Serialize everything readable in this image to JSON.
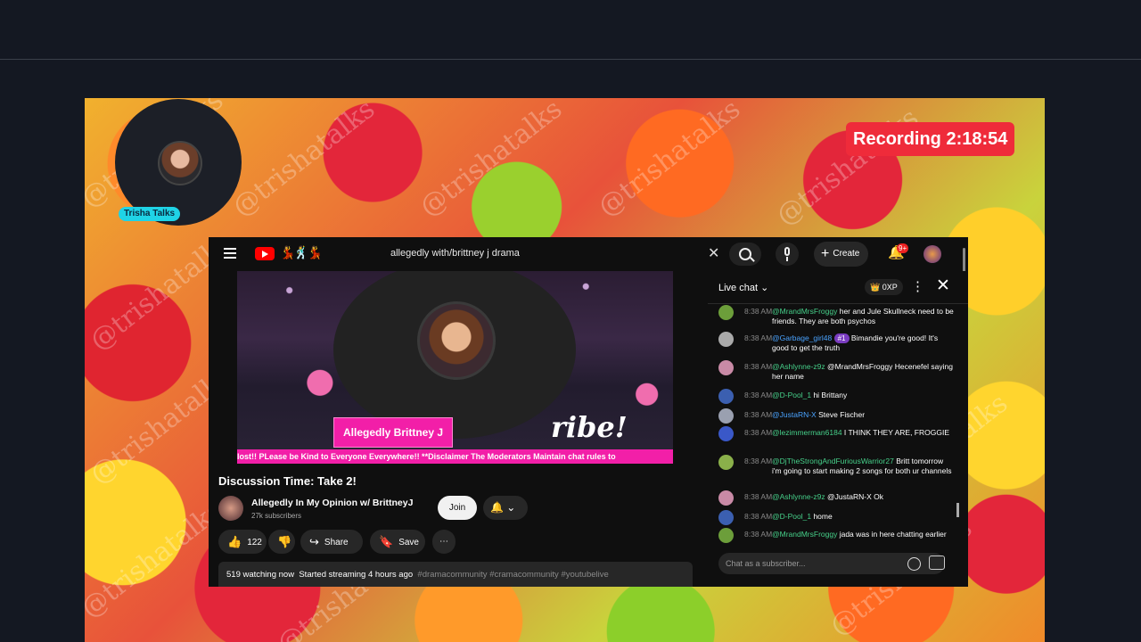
{
  "recording": {
    "label": "Recording 2:18:54"
  },
  "webcam": {
    "name": "Trisha Talks"
  },
  "watermark": "@trishatalks",
  "youtube": {
    "search_query": "allegedly with/brittney j drama",
    "create_label": "Create",
    "notification_count": "9+",
    "video": {
      "name_card": "Allegedly Brittney J",
      "overlay_text": "ribe!",
      "ticker": "lost!! PLease be Kind to Everyone Everywhere!! **Disclaimer The Moderators Maintain chat rules to"
    },
    "title": "Discussion Time: Take 2!",
    "channel": {
      "name": "Allegedly In My Opinion w/ BrittneyJ",
      "subs": "27k subscribers"
    },
    "join_label": "Join",
    "likes": "122",
    "share_label": "Share",
    "save_label": "Save",
    "description": {
      "watching": "519 watching now",
      "started": "Started streaming 4 hours ago",
      "tags": "#dramacommunity #cramacommunity #youtubelive"
    }
  },
  "chat": {
    "title": "Live chat",
    "xp": "0XP",
    "placeholder": "Chat as a subscriber...",
    "messages": [
      {
        "time": "8:38 AM",
        "user": "@MrandMrsFroggy",
        "text": "her and Jule Skullneck need to be friends. They are both psychos"
      },
      {
        "time": "8:38 AM",
        "user": "@Garbage_girl48",
        "badge": "#1",
        "text": "Bimandie you're good! It's good to get the truth"
      },
      {
        "time": "8:38 AM",
        "user": "@Ashlynne-z9z",
        "text": "@MrandMrsFroggy Hecenefel saying her name"
      },
      {
        "time": "8:38 AM",
        "user": "@D-Pool_1",
        "text": "hi Brittany"
      },
      {
        "time": "8:38 AM",
        "user": "@JustaRN-X",
        "text": "Steve Fischer"
      },
      {
        "time": "8:38 AM",
        "user": "@lezimmerman6184",
        "text": "I THINK THEY ARE, FROGGIE"
      },
      {
        "time": "8:38 AM",
        "user": "@DjTheStrongAndFuriousWarrior27",
        "text": "Britt tomorrow i'm going to start making 2 songs for both ur channels"
      },
      {
        "time": "8:38 AM",
        "user": "@Ashlynne-z9z",
        "text": "@JustaRN-X Ok"
      },
      {
        "time": "8:38 AM",
        "user": "@D-Pool_1",
        "text": "home"
      },
      {
        "time": "8:38 AM",
        "user": "@MrandMrsFroggy",
        "text": "jada was in here chatting earlier"
      }
    ]
  }
}
